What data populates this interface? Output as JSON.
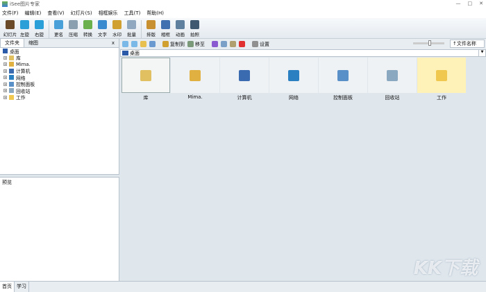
{
  "title": "iSee图片专家",
  "window_controls": [
    "—",
    "□",
    "✕"
  ],
  "menu": [
    "文件(F)",
    "编辑(E)",
    "查看(V)",
    "幻灯片(S)",
    "相框娱乐",
    "工具(T)",
    "帮助(H)"
  ],
  "toolbar": [
    {
      "label": "幻灯片",
      "color": "#6b4a2a"
    },
    {
      "label": "左旋",
      "color": "#2a9fd8"
    },
    {
      "label": "右旋",
      "color": "#2a9fd8"
    },
    {
      "label": "更名",
      "color": "#4aa0d8"
    },
    {
      "label": "压缩",
      "color": "#8aa0b0"
    },
    {
      "label": "转换",
      "color": "#6ab04c"
    },
    {
      "label": "文字",
      "color": "#3a8ad0"
    },
    {
      "label": "水印",
      "color": "#d0a030"
    },
    {
      "label": "批量",
      "color": "#90a8c0"
    },
    {
      "label": "排版",
      "color": "#c89030"
    },
    {
      "label": "相框",
      "color": "#4070b0"
    },
    {
      "label": "动画",
      "color": "#6080a0"
    },
    {
      "label": "拍照",
      "color": "#405870"
    }
  ],
  "left_tabs": [
    "文件夹",
    "缩图"
  ],
  "left_close": "x",
  "tree_root": "桌面",
  "tree": [
    {
      "label": "库",
      "color": "#e0c060"
    },
    {
      "label": "Mima.",
      "color": "#e0b040"
    },
    {
      "label": "计算机",
      "color": "#3a6ab0"
    },
    {
      "label": "网络",
      "color": "#2a80c0"
    },
    {
      "label": "控制面板",
      "color": "#5a90c8"
    },
    {
      "label": "回收站",
      "color": "#8aa8c0"
    },
    {
      "label": "工作",
      "color": "#f0c850"
    }
  ],
  "preview_label": "预览",
  "right_toolbar": {
    "copy_to": "复制到",
    "move_to": "移至",
    "settings": "设置",
    "sort": "↑文件名称"
  },
  "address": "桌面",
  "items": [
    {
      "label": "库",
      "color": "#e0c060"
    },
    {
      "label": "Mima.",
      "color": "#e0b040"
    },
    {
      "label": "计算机",
      "color": "#3a6ab0"
    },
    {
      "label": "网络",
      "color": "#2a80c0"
    },
    {
      "label": "控制面板",
      "color": "#5a90c8"
    },
    {
      "label": "回收站",
      "color": "#8aa8c0"
    },
    {
      "label": "工作",
      "color": "#f0c850"
    }
  ],
  "status_tabs": [
    "首页",
    "学习"
  ],
  "watermark": "KK下载"
}
